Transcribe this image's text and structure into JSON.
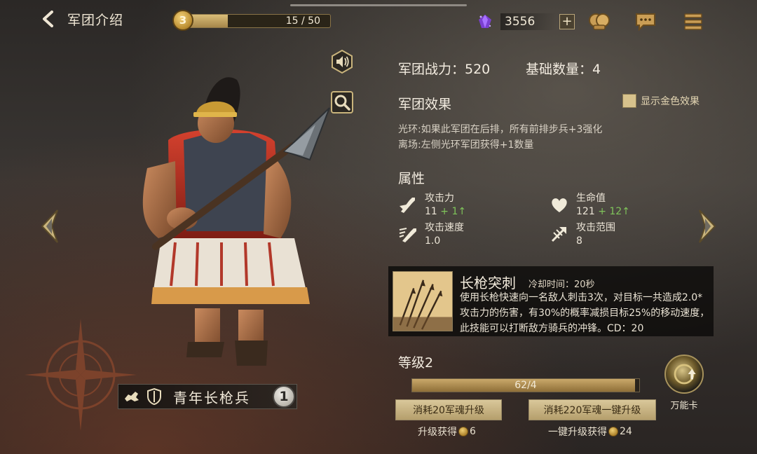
{
  "header": {
    "back_label": "军团介绍"
  },
  "level_bar": {
    "level": "3",
    "progress_text": "15 / 50",
    "progress_value": 15,
    "progress_max": 50
  },
  "currency": {
    "amount": "3556",
    "plus": "+"
  },
  "character": {
    "name": "青年长枪兵",
    "star": "1"
  },
  "stats_head": {
    "power": "军团战力：520",
    "base_count": "基础数量：4"
  },
  "effects": {
    "title": "军团效果",
    "gold_toggle": "显示金色效果",
    "aura": "光环:如果此军团在后排，所有前排步兵+3强化",
    "leave": "离场:左侧光环军团获得+1数量"
  },
  "attributes": {
    "title": "属性",
    "attack": {
      "name": "攻击力",
      "value": "11",
      "bonus": "+ 1↑"
    },
    "hp": {
      "name": "生命值",
      "value": "121",
      "bonus": "+ 12↑"
    },
    "attack_speed": {
      "name": "攻击速度",
      "value": "1.0"
    },
    "attack_range": {
      "name": "攻击范围",
      "value": "8"
    }
  },
  "skill": {
    "name": "长枪突刺",
    "cooldown": "冷却时间：20秒",
    "desc": "使用长枪快速向一名敌人刺击3次，对目标一共造成2.0*攻击力的伤害，有30%的概率减损目标25%的移动速度，此技能可以打断敌方骑兵的冲锋。CD：20"
  },
  "upgrade": {
    "level_title": "等级2",
    "exp_text": "62/4",
    "exp_fill": 0.98,
    "btn_single": "消耗20军魂升级",
    "btn_all": "消耗220军魂一键升级",
    "gain_single_label": "升级获得",
    "gain_single_value": "6",
    "gain_all_label": "一键升级获得",
    "gain_all_value": "24"
  },
  "universal_card": {
    "label": "万能卡"
  },
  "icons": {
    "sound": "speaker-icon",
    "zoom": "magnifier-icon",
    "prev": "chevron-left-icon",
    "next": "chevron-right-icon",
    "gem": "purple-gem-icon",
    "guild": "guild-icon",
    "chat": "chat-icon",
    "menu": "menu-icon"
  },
  "colors": {
    "bonus_green": "#7fc45a",
    "gold": "#d7c28c"
  }
}
